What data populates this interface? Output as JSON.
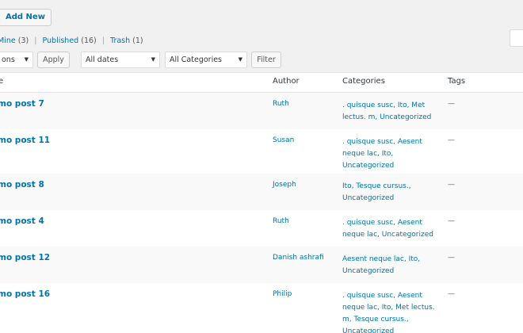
{
  "toolbar": {
    "add_new_label": "Add New"
  },
  "filters": {
    "mine_label": "Mine",
    "mine_count": "(3)",
    "published_label": "Published",
    "published_count": "(16)",
    "trash_label": "Trash",
    "trash_count": "(1)",
    "separator": "|"
  },
  "bulk": {
    "actions_value": "ons",
    "apply_label": "Apply",
    "dates_value": "All dates",
    "categories_value": "All Categories",
    "filter_label": "Filter"
  },
  "table": {
    "headers": {
      "title": "e",
      "author": "Author",
      "categories": "Categories",
      "tags": "Tags"
    },
    "rows": [
      {
        "title": "mo post 7",
        "author": "Ruth",
        "categories": ". quisque susc, Ito, Met lectus. m, Uncategorized",
        "tags": "—"
      },
      {
        "title": "mo post 11",
        "author": "Susan",
        "categories": ". quisque susc, Aesent neque lac, Ito, Uncategorized",
        "tags": "—"
      },
      {
        "title": "mo post 8",
        "author": "Joseph",
        "categories": "Ito, Tesque cursus., Uncategorized",
        "tags": "—"
      },
      {
        "title": "mo post 4",
        "author": "Ruth",
        "categories": ". quisque susc, Aesent neque lac, Uncategorized",
        "tags": "—"
      },
      {
        "title": "mo post 12",
        "author": "Danish ashrafi",
        "categories": "Aesent neque lac, Ito, Uncategorized",
        "tags": "—"
      },
      {
        "title": "mo post 16",
        "author": "Philip",
        "categories": ". quisque susc, Aesent neque lac, Ito, Met lectus. m, Tesque cursus., Uncategorized",
        "tags": "—"
      }
    ]
  },
  "icons": {
    "dropdown_arrow": "▼"
  },
  "colors": {
    "link": "#0073aa",
    "background": "#f1f1f1",
    "alt_row": "#f9f9f9"
  }
}
